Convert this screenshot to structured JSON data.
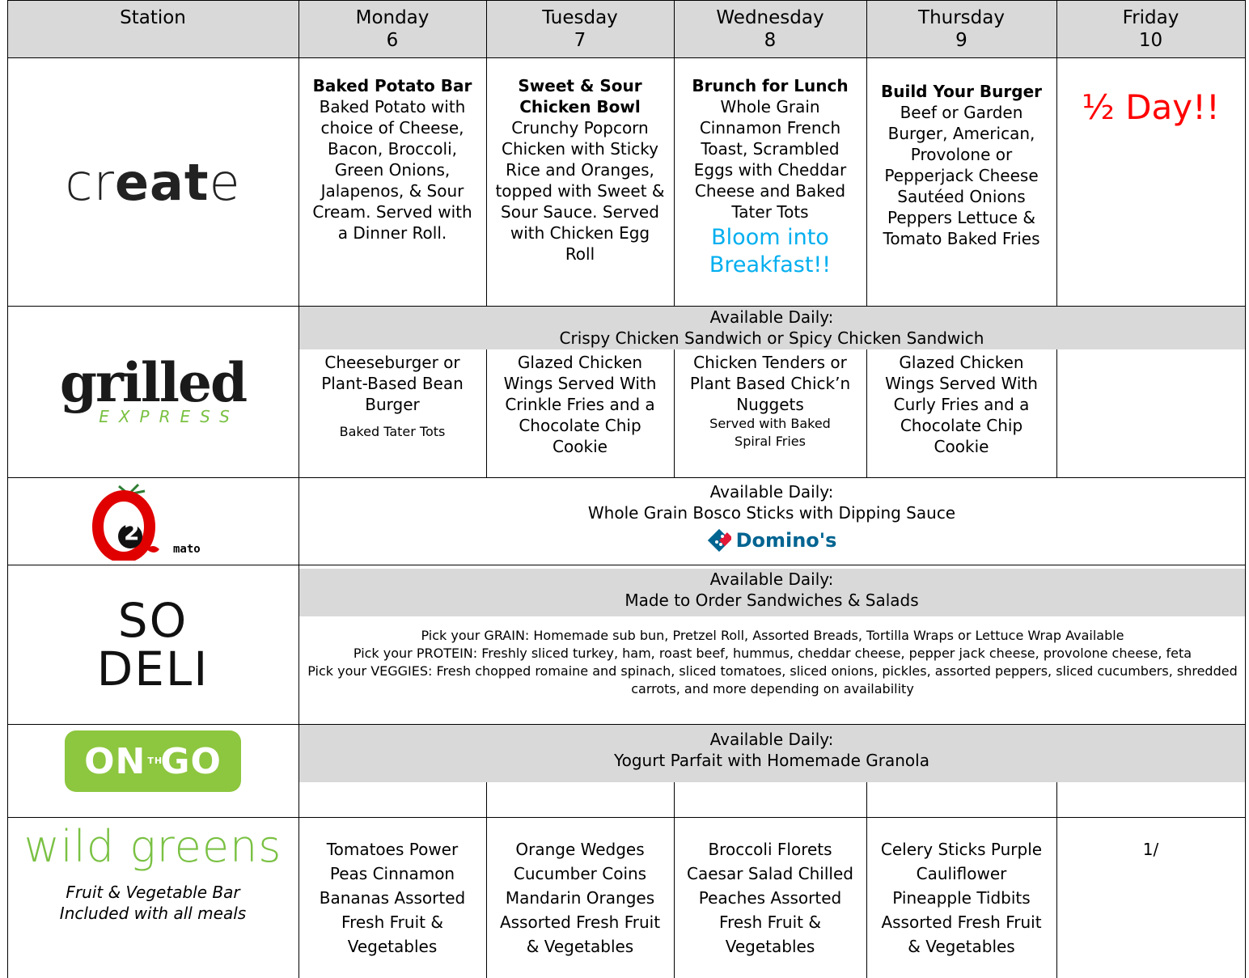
{
  "header": {
    "station": "Station",
    "days": [
      {
        "name": "Monday",
        "num": "6"
      },
      {
        "name": "Tuesday",
        "num": "7"
      },
      {
        "name": "Wednesday",
        "num": "8"
      },
      {
        "name": "Thursday",
        "num": "9"
      },
      {
        "name": "Friday",
        "num": "10"
      }
    ]
  },
  "create": {
    "logo_pre": "cr",
    "logo_bold": "eat",
    "logo_post": "e",
    "monday": {
      "title": "Baked Potato Bar",
      "body": "Baked Potato with choice of Cheese, Bacon, Broccoli, Green Onions, Jalapenos, & Sour Cream. Served with a Dinner Roll."
    },
    "tuesday": {
      "title": "Sweet & Sour Chicken Bowl",
      "body": "Crunchy Popcorn Chicken with Sticky Rice and Oranges, topped with Sweet & Sour Sauce. Served with Chicken Egg Roll"
    },
    "wednesday": {
      "title": "Brunch for Lunch",
      "body": "Whole Grain Cinnamon French Toast, Scrambled Eggs with Cheddar Cheese and Baked Tater Tots",
      "extra": "Bloom into Breakfast!!",
      "extra_color": "#00aeef"
    },
    "thursday": {
      "title": "Build Your Burger",
      "body": "Beef or Garden Burger, American, Provolone or Pepperjack Cheese Sautéed Onions Peppers Lettuce & Tomato Baked Fries"
    },
    "friday": {
      "text": "½ Day!!",
      "color": "#ff0000"
    }
  },
  "grilled": {
    "logo_main": "grilled",
    "logo_sub": "EXPRESS",
    "daily_label": "Available Daily:",
    "daily_items": "Crispy Chicken Sandwich or Spicy Chicken Sandwich",
    "monday": {
      "main": "Cheeseburger or Plant-Based Bean Burger",
      "side": "Baked Tater Tots"
    },
    "tuesday": {
      "main": "Glazed Chicken Wings Served With Crinkle Fries and a Chocolate Chip Cookie"
    },
    "wednesday": {
      "main": "Chicken Tenders or Plant Based Chick’n Nuggets",
      "side": "Served with Baked Spiral Fries"
    },
    "thursday": {
      "main": "Glazed Chicken Wings Served With Curly Fries and a Chocolate Chip Cookie"
    }
  },
  "o2mato": {
    "logo_num": "2",
    "logo_text": "mato",
    "daily_label": "Available Daily:",
    "daily_items": "Whole Grain Bosco Sticks with Dipping Sauce",
    "brand": "Domino's"
  },
  "deli": {
    "logo_line1": "SO",
    "logo_line2": "DELI",
    "daily_label": "Available Daily:",
    "daily_items": "Made to Order Sandwiches & Salads",
    "grain": "Pick your GRAIN: Homemade sub bun, Pretzel Roll, Assorted Breads, Tortilla Wraps or Lettuce Wrap Available",
    "protein": "Pick your PROTEIN: Freshly sliced turkey, ham, roast beef, hummus, cheddar cheese, pepper jack cheese, provolone cheese, feta",
    "veggies": "Pick your VEGGIES: Fresh chopped romaine and spinach, sliced tomatoes, sliced onions, pickles, assorted peppers, sliced cucumbers, shredded carrots, and more depending on availability"
  },
  "onthego": {
    "logo_left": "ON",
    "logo_mid": "THE",
    "logo_right": "GO",
    "daily_label": "Available Daily:",
    "daily_items": "Yogurt Parfait with Homemade Granola"
  },
  "wildgreens": {
    "logo": "wild greens",
    "desc": "Fruit & Vegetable Bar Included with all meals",
    "monday": "Tomatoes Power Peas Cinnamon Bananas Assorted Fresh Fruit & Vegetables",
    "tuesday": "Orange Wedges Cucumber Coins Mandarin Oranges Assorted Fresh Fruit & Vegetables",
    "wednesday": "Broccoli Florets Caesar Salad Chilled Peaches Assorted Fresh Fruit & Vegetables",
    "thursday": "Celery Sticks Purple Cauliflower Pineapple Tidbits Assorted Fresh Fruit & Vegetables",
    "friday": "1/"
  }
}
